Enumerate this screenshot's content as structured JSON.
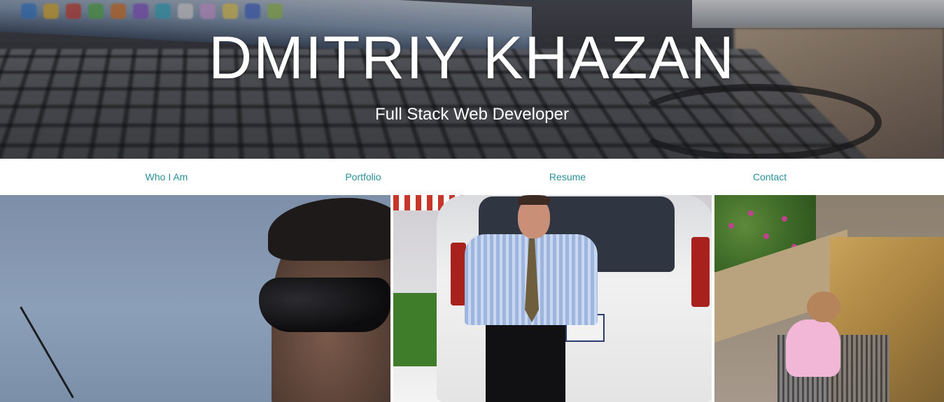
{
  "hero": {
    "title": "DMITRIY KHAZAN",
    "subtitle": "Full Stack Web Developer",
    "background": "blurred photo of a laptop keyboard and desk"
  },
  "nav": {
    "items": [
      {
        "label": "Who I Am"
      },
      {
        "label": "Portfolio"
      },
      {
        "label": "Resume"
      },
      {
        "label": "Contact"
      }
    ]
  },
  "gallery": {
    "photos": [
      {
        "subject": "man with sunglasses fishing under a blue sky"
      },
      {
        "subject": "man in shirt and tie standing in front of a white SUV"
      },
      {
        "subject": "child playing at a stone water fountain near flowers"
      }
    ]
  },
  "colors": {
    "nav_link": "#2a8f99",
    "hero_text": "#ffffff",
    "page_background": "#ffffff"
  }
}
